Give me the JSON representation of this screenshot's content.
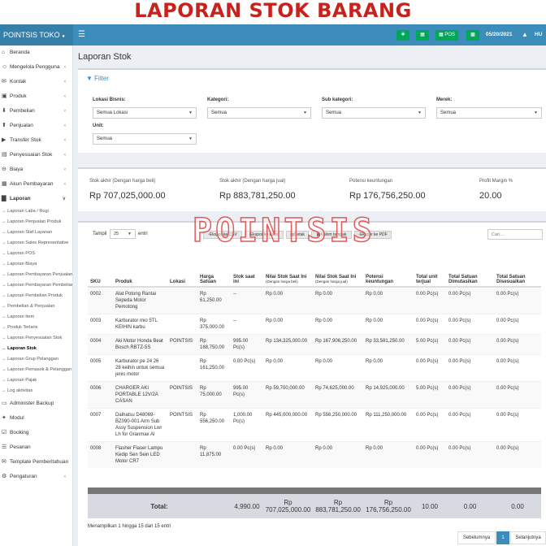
{
  "banner": {
    "text": "LAPORAN STOK BARANG"
  },
  "app": {
    "brand": "POINTSIS TOKO"
  },
  "topbar": {
    "pos_label": "POS",
    "date": "05/20/2021",
    "user": "HU"
  },
  "sidebar": {
    "items": [
      {
        "label": "Beranda",
        "icon": "home-icon"
      },
      {
        "label": "Mengelola Pengguna",
        "icon": "users-icon",
        "chevron": true
      },
      {
        "label": "Kontak",
        "icon": "address-book-icon",
        "chevron": true
      },
      {
        "label": "Produk",
        "icon": "cubes-icon",
        "chevron": true
      },
      {
        "label": "Pembelian",
        "icon": "arrow-circle-down-icon",
        "chevron": true
      },
      {
        "label": "Penjualan",
        "icon": "arrow-circle-up-icon",
        "chevron": true
      },
      {
        "label": "Transfer Stok",
        "icon": "truck-icon",
        "chevron": true
      },
      {
        "label": "Penyesuaian Stok",
        "icon": "database-icon",
        "chevron": true
      },
      {
        "label": "Biaya",
        "icon": "minus-circle-icon",
        "chevron": true
      },
      {
        "label": "Akun Pembayaran",
        "icon": "money-icon",
        "chevron": true
      },
      {
        "label": "Laporan",
        "icon": "bar-chart-icon",
        "chevron": true
      }
    ],
    "reports": [
      "Laporan Laba / Rugi",
      "Laporan Penjualan Produk",
      "Laporan Staf Layanan",
      "Laporan Sales Representative",
      "Laporan POS",
      "Laporan Biaya",
      "Laporan Pembayaran Penjualan",
      "Laporan Pembayaran Pembelian",
      "Laporan Pembelian Produk",
      "Pembelian & Penjualan",
      "Laporan Item",
      "Produk Terlaris",
      "Laporan Penyesuaian Stok",
      "Laporan Stok",
      "Laporan Grup Pelanggan",
      "Laporan Pemasok & Pelanggan",
      "Laporan Pajak",
      "Log aktivitas"
    ],
    "bottom_items": [
      {
        "label": "Administer Backup",
        "icon": "hdd-icon"
      },
      {
        "label": "Modul",
        "icon": "plug-icon"
      },
      {
        "label": "Booking",
        "icon": "calendar-check-icon"
      },
      {
        "label": "Pesanan",
        "icon": "list-alt-icon"
      },
      {
        "label": "Template Pemberitahuan",
        "icon": "envelope-icon"
      },
      {
        "label": "Pengaturan",
        "icon": "cog-icon",
        "chevron": true
      }
    ]
  },
  "page": {
    "title": "Laporan Stok"
  },
  "filter": {
    "title": "Filter",
    "location_label": "Lokasi Bisnis:",
    "location_value": "Semua Lokasi",
    "category_label": "Kategori:",
    "category_value": "Semua",
    "subcategory_label": "Sub kategori:",
    "subcategory_value": "Semua",
    "brand_label": "Merek:",
    "brand_value": "Semua",
    "unit_label": "Unit:",
    "unit_value": "Semua"
  },
  "summary": {
    "buy_label": "Stok akhir (Dengan harga beli)",
    "buy_value": "Rp 707,025,000.00",
    "sell_label": "Stok akhir (Dengan harga jual)",
    "sell_value": "Rp 883,781,250.00",
    "profit_label": "Potensi keuntungan",
    "profit_value": "Rp 176,756,250.00",
    "margin_label": "Profit Margin %",
    "margin_value": "20.00"
  },
  "table_controls": {
    "show_label": "Tampil",
    "page_size": "25",
    "entries_label": "entri",
    "export_csv": "Ekspor ke CSV",
    "export_excel": "Ekspor ke Excel",
    "print": "Cetak",
    "columns": "Kolom tampak",
    "export_pdf": "Ekspor ke PDF",
    "search_placeholder": "Cari ..."
  },
  "watermark": "POINTSIS",
  "table": {
    "columns": [
      "SKU",
      "Produk",
      "Lokasi",
      "Harga Satuan",
      "Stok saat ini",
      "Nilai Stok Saat Ini",
      "Nilai Stok Saat Ini",
      "Potensi keuntungan",
      "Total unit terjual",
      "Total Satuan Dimutasikan",
      "Total Satuan Disesuaikan"
    ],
    "col_subs": {
      "buy": "(Dengan harga beli)",
      "sell": "(Dengan harga jual)"
    },
    "rows": [
      [
        "0002",
        "Alat Potong Rantai Sepeda Motor Pemotong",
        "",
        "Rp 61,250.00",
        "--",
        "Rp 0.00",
        "Rp 0.00",
        "Rp 0.00",
        "0.00 Pc(s)",
        "0.00 Pc(s)",
        "0.00 Pc(s)"
      ],
      [
        "0003",
        "Karburator mio 5TL KEIHIN karbu",
        "",
        "Rp 375,000.00",
        "--",
        "Rp 0.00",
        "Rp 0.00",
        "Rp 0.00",
        "0.00 Pc(s)",
        "0.00 Pc(s)",
        "0.00 Pc(s)"
      ],
      [
        "0004",
        "Aki Motor Honda Beat Bosch RBTZ-5S",
        "POINTSIS",
        "Rp 168,750.00",
        "995.00 Pc(s)",
        "Rp 134,325,000.00",
        "Rp 167,906,250.00",
        "Rp 33,581,250.00",
        "5.00 Pc(s)",
        "0.00 Pc(s)",
        "0.00 Pc(s)"
      ],
      [
        "0005",
        "Karburator pe 24 26 28 keihin untuk semua jenis motor",
        "",
        "Rp 161,250.00",
        "0.00 Pc(s)",
        "Rp 0.00",
        "Rp 0.00",
        "Rp 0.00",
        "0.00 Pc(s)",
        "0.00 Pc(s)",
        "0.00 Pc(s)"
      ],
      [
        "0006",
        "CHARGER AKI PORTABLE 12V/2A CASAN",
        "POINTSIS",
        "Rp 75,000.00",
        "995.00 Pc(s)",
        "Rp 59,700,000.00",
        "Rp 74,625,000.00",
        "Rp 14,925,000.00",
        "5.00 Pc(s)",
        "0.00 Pc(s)",
        "0.00 Pc(s)"
      ],
      [
        "0007",
        "Daihatsu D48069-BZ090-001 Arm Sub Assy Suspension Lwr Lh for Granmax Al",
        "POINTSIS",
        "Rp 556,250.00",
        "1,000.00 Pc(s)",
        "Rp 445,000,000.00",
        "Rp 556,250,000.00",
        "Rp 111,250,000.00",
        "0.00 Pc(s)",
        "0.00 Pc(s)",
        "0.00 Pc(s)"
      ],
      [
        "0008",
        "Flasher Flaser Lampu Kedip Sen Sein LED Motor CR7",
        "",
        "Rp 11,875.00",
        "0.00 Pc(s)",
        "Rp 0.00",
        "Rp 0.00",
        "Rp 0.00",
        "0.00 Pc(s)",
        "0.00 Pc(s)",
        "0.00 Pc(s)"
      ]
    ],
    "totals": {
      "label": "Total:",
      "stock": "4,990.00",
      "buy": "Rp 707,025,000.00",
      "sell": "Rp 883,781,250.00",
      "profit": "Rp 176,756,250.00",
      "sold": "10.00",
      "transferred": "0.00",
      "adjusted": "0.00"
    }
  },
  "pagination": {
    "info": "Menampilkan 1 hingga 15 dari 15 entri",
    "prev": "Sebelumnya",
    "page": "1",
    "next": "Selanjutnya"
  }
}
